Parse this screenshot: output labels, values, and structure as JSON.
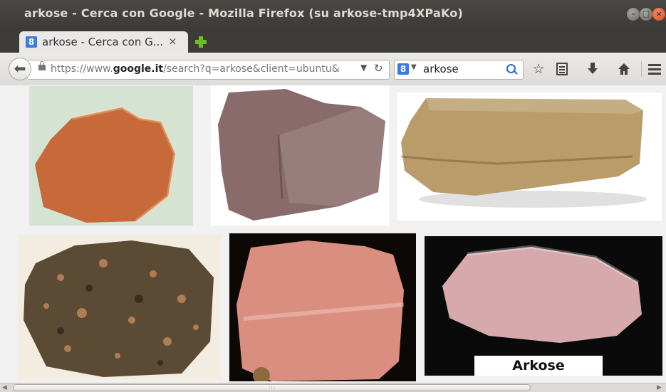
{
  "window": {
    "title": "arkose - Cerca con Google - Mozilla Firefox (su arkose-tmp4XPaKo)"
  },
  "tab": {
    "title": "arkose - Cerca con G...",
    "close": "×",
    "favicon": "8"
  },
  "navbar": {
    "url_prefix": "https://www.",
    "url_host": "google.it",
    "url_rest": "/search?q=arkose&client=ubuntu&",
    "search_engine_icon": "8",
    "search_text": "arkose"
  },
  "icons": [
    "back-icon",
    "lock-icon",
    "dropdown-icon",
    "reload-icon",
    "search-icon",
    "bookmark-star-icon",
    "reading-list-icon",
    "download-icon",
    "home-icon",
    "menu-icon",
    "new-tab-icon"
  ],
  "images": [
    {
      "name": "arkose-image-1",
      "bg": "#d4e3d2",
      "rock": "#c8693a"
    },
    {
      "name": "arkose-image-2",
      "bg": "#ffffff",
      "rock": "#8a6b6c"
    },
    {
      "name": "arkose-image-3",
      "bg": "#ffffff",
      "rock": "#b99c6a"
    },
    {
      "name": "arkose-image-4",
      "bg": "#f3ece1",
      "rock": "#5b4a34"
    },
    {
      "name": "arkose-image-5",
      "bg": "#0c0806",
      "rock": "#d98e80"
    },
    {
      "name": "arkose-image-6",
      "bg": "#0a0a0a",
      "rock": "#d6a9ac"
    }
  ],
  "image_caption": "Arkose"
}
